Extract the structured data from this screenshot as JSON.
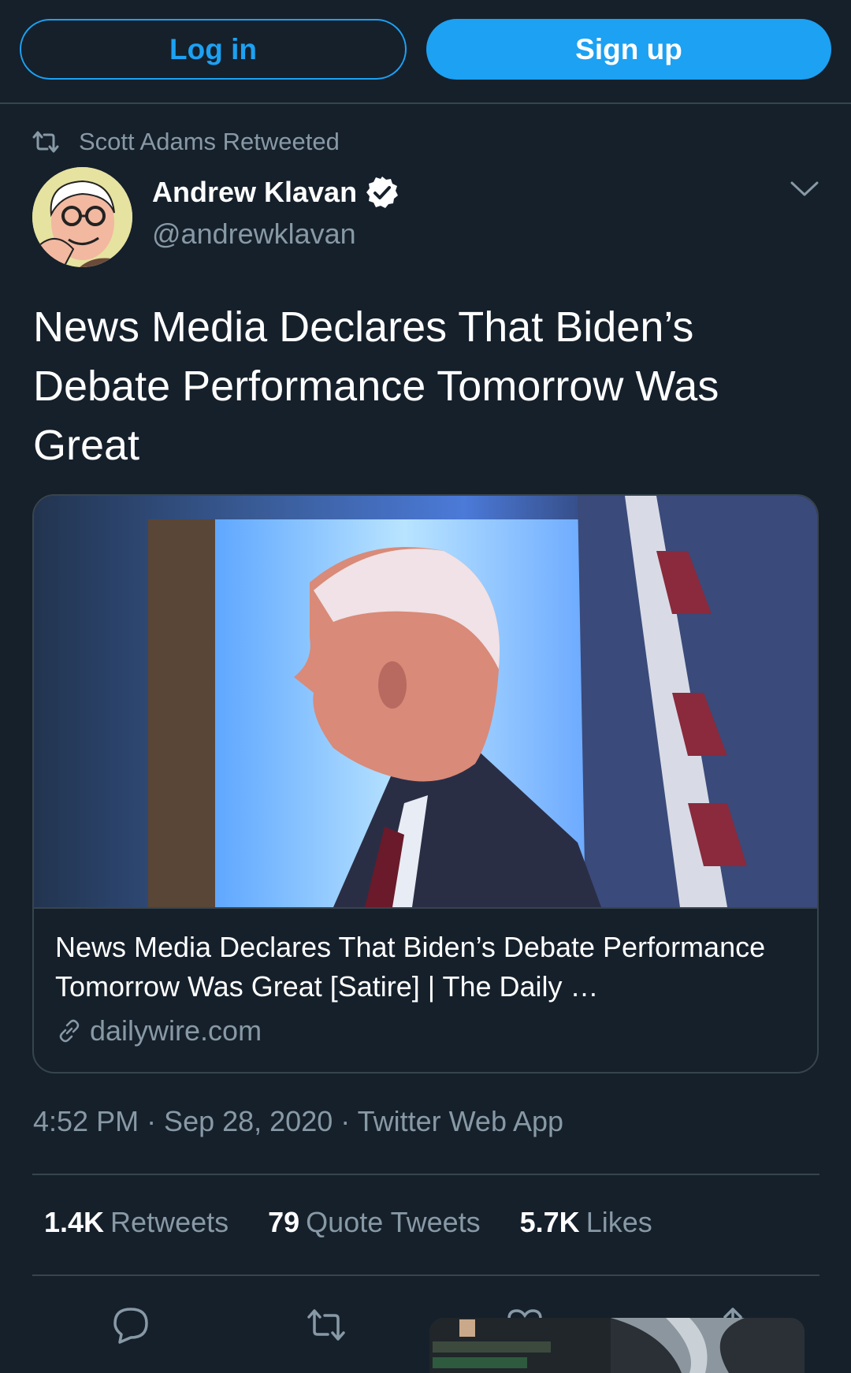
{
  "header": {
    "login_label": "Log in",
    "signup_label": "Sign up"
  },
  "tweet": {
    "retweeted_by": "Scott Adams Retweeted",
    "author_name": "Andrew Klavan",
    "author_handle": "@andrewklavan",
    "text": "News Media Declares That Biden’s Debate Performance Tomorrow Was Great",
    "card": {
      "title": "News Media Declares That Biden’s Debate Performance Tomorrow Was Great [Satire] | The Daily …",
      "domain": "dailywire.com"
    },
    "timestamp": "4:52 PM · Sep 28, 2020 · Twitter Web App",
    "stats": {
      "retweets_count": "1.4K",
      "retweets_label": "Retweets",
      "quotes_count": "79",
      "quotes_label": "Quote Tweets",
      "likes_count": "5.7K",
      "likes_label": "Likes"
    }
  },
  "icons": {
    "retweet": "retweet-icon",
    "verified": "verified-badge-icon",
    "caret": "chevron-down-icon",
    "link": "link-icon",
    "reply": "reply-icon",
    "like": "heart-icon",
    "share": "share-icon"
  },
  "colors": {
    "background": "#15202b",
    "accent": "#1da1f2",
    "secondary_text": "#8899a6",
    "border": "#38444d"
  }
}
